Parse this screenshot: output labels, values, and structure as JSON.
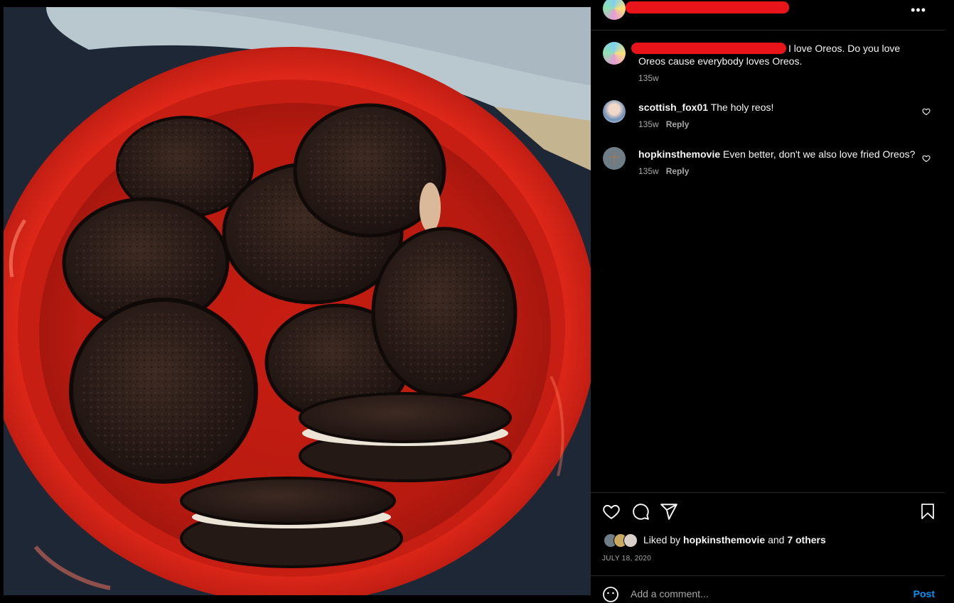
{
  "post_header": {
    "username_hidden": true,
    "more_icon": "more-horizontal-icon"
  },
  "caption": {
    "text": "I love Oreos. Do you love Oreos cause everybody loves Oreos.",
    "time": "135w"
  },
  "comments": [
    {
      "username": "scottish_fox01",
      "text": "The holy reos!",
      "time": "135w",
      "reply": "Reply"
    },
    {
      "username": "hopkinsthemovie",
      "text": "Even better, don't we also love fried Oreos?",
      "time": "135w",
      "reply": "Reply"
    }
  ],
  "actions": {
    "like_icon": "heart-icon",
    "comment_icon": "comment-icon",
    "share_icon": "share-icon",
    "save_icon": "bookmark-icon"
  },
  "likes": {
    "prefix": "Liked by",
    "user": "hopkinsthemovie",
    "joiner": "and",
    "others": "7 others"
  },
  "date": "JULY 18, 2020",
  "add_comment": {
    "placeholder": "Add a comment...",
    "post_label": "Post",
    "emoji_icon": "emoji-icon"
  },
  "colors": {
    "background": "#000000",
    "text": "#f5f5f5",
    "muted": "#a8a8a8",
    "divider": "#262626",
    "link": "#0095f6",
    "redaction": "#e8141a"
  }
}
